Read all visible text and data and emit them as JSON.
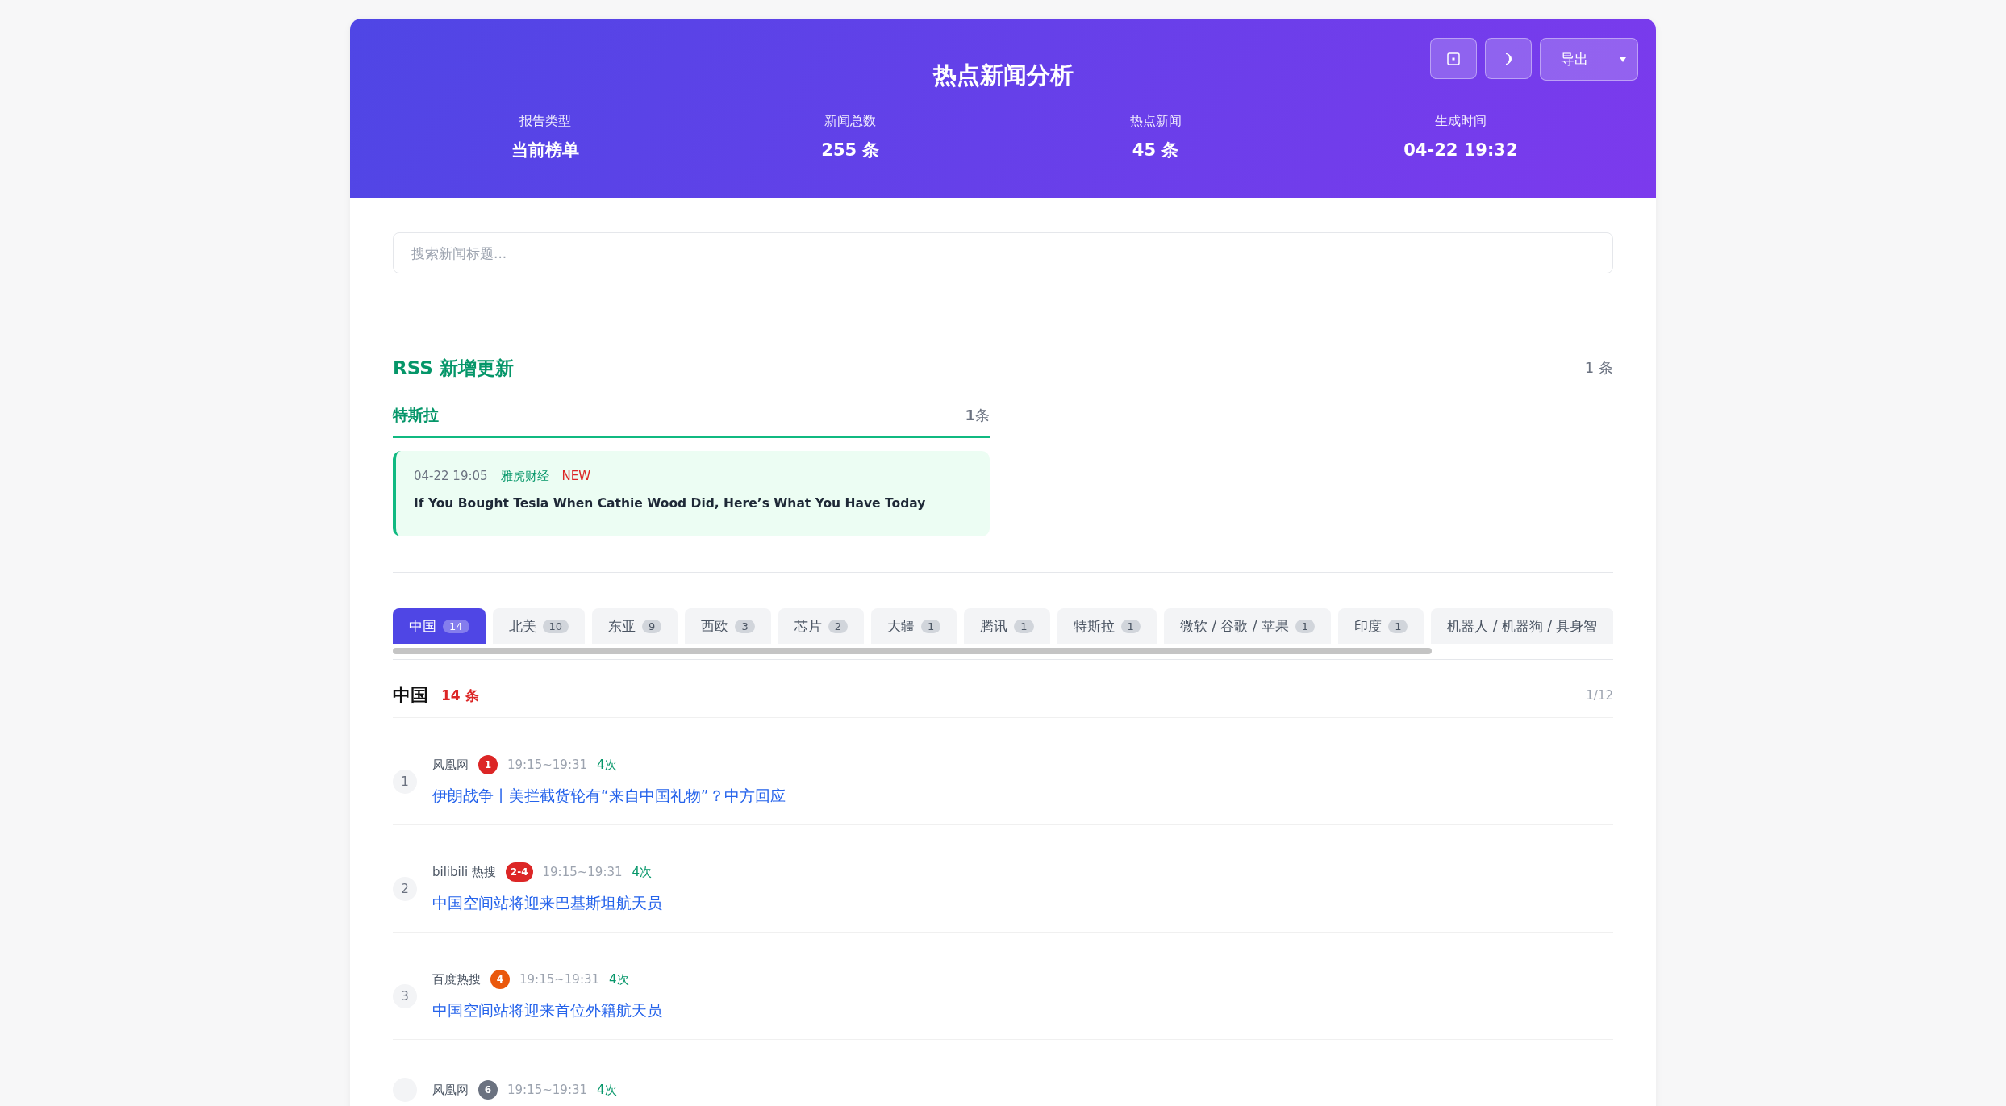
{
  "header": {
    "title": "热点新闻分析",
    "export_label": "导出",
    "stats": [
      {
        "label": "报告类型",
        "value": "当前榜单"
      },
      {
        "label": "新闻总数",
        "value": "255 条"
      },
      {
        "label": "热点新闻",
        "value": "45 条"
      },
      {
        "label": "生成时间",
        "value": "04-22 19:32"
      }
    ]
  },
  "search": {
    "placeholder": "搜索新闻标题..."
  },
  "rss": {
    "title": "RSS 新增更新",
    "count": "1 条",
    "groups": [
      {
        "name": "特斯拉",
        "count": "**1**条",
        "items": [
          {
            "time": "04-22 19:05",
            "source": "雅虎财经",
            "badge": "NEW",
            "title": "If You Bought Tesla When Cathie Wood Did, Here’s What You Have Today"
          }
        ]
      }
    ]
  },
  "tabs": [
    {
      "label": "中国",
      "count": "14",
      "selected": true
    },
    {
      "label": "北美",
      "count": "10",
      "selected": false
    },
    {
      "label": "东亚",
      "count": "9",
      "selected": false
    },
    {
      "label": "西欧",
      "count": "3",
      "selected": false
    },
    {
      "label": "芯片",
      "count": "2",
      "selected": false
    },
    {
      "label": "大疆",
      "count": "1",
      "selected": false
    },
    {
      "label": "腾讯",
      "count": "1",
      "selected": false
    },
    {
      "label": "特斯拉",
      "count": "1",
      "selected": false
    },
    {
      "label": "微软 / 谷歌 / 苹果",
      "count": "1",
      "selected": false
    },
    {
      "label": "印度",
      "count": "1",
      "selected": false
    },
    {
      "label": "机器人 / 机器狗 / 具身智",
      "selected": false
    }
  ],
  "section": {
    "title": "中国",
    "count": "14 条",
    "page": "1/12"
  },
  "news": [
    {
      "number": "1",
      "source": "凤凰网",
      "rank": "1",
      "color": "#dc2626",
      "time_range": "19:15~19:31",
      "times": "4次",
      "title": "伊朗战争丨美拦截货轮有“来自中国礼物”？中方回应"
    },
    {
      "number": "2",
      "source": "bilibili 热搜",
      "rank": "2-4",
      "color": "#dc2626",
      "time_range": "19:15~19:31",
      "times": "4次",
      "title": "中国空间站将迎来巴基斯坦航天员"
    },
    {
      "number": "3",
      "source": "百度热搜",
      "rank": "4",
      "color": "#ea580c",
      "time_range": "19:15~19:31",
      "times": "4次",
      "title": "中国空间站将迎来首位外籍航天员"
    },
    {
      "source": "凤凰网",
      "rank": "6",
      "color": "#6b7280",
      "time_range": "19:15~19:31",
      "times": "4次"
    }
  ]
}
